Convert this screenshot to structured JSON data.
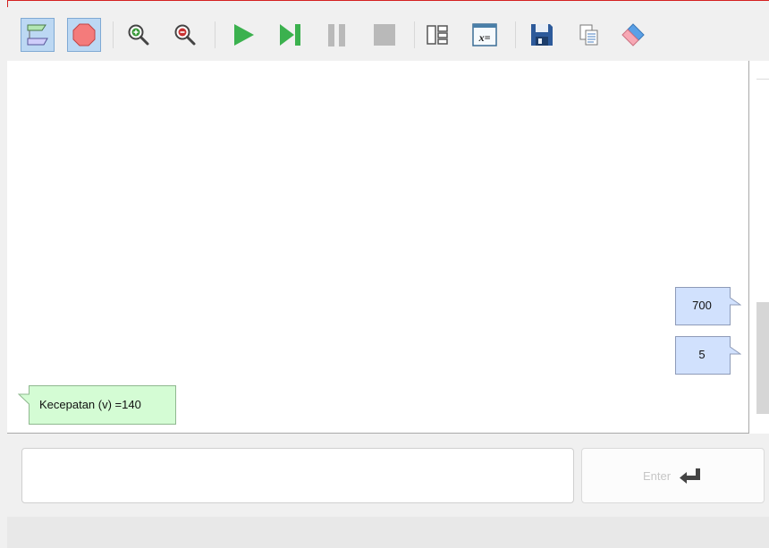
{
  "toolbar": {
    "buttons": [
      {
        "name": "mode-flowchart-button",
        "icon": "flowchart-icon",
        "pressed": true
      },
      {
        "name": "stop-mode-button",
        "icon": "stop-octagon-icon",
        "pressed": true
      },
      {
        "name": "zoom-in-button",
        "icon": "zoom-in-icon"
      },
      {
        "name": "zoom-out-button",
        "icon": "zoom-out-icon"
      },
      {
        "name": "run-button",
        "icon": "play-icon"
      },
      {
        "name": "step-button",
        "icon": "step-forward-icon"
      },
      {
        "name": "pause-button",
        "icon": "pause-icon"
      },
      {
        "name": "stop-button",
        "icon": "stop-square-icon"
      },
      {
        "name": "layout-button",
        "icon": "layout-icon"
      },
      {
        "name": "variables-button",
        "icon": "variables-icon",
        "text": "x="
      },
      {
        "name": "save-button",
        "icon": "floppy-disk-icon"
      },
      {
        "name": "copy-button",
        "icon": "copy-icon"
      },
      {
        "name": "clear-button",
        "icon": "eraser-icon"
      }
    ]
  },
  "console": {
    "input_1": "700",
    "input_2": "5",
    "output_1": "Kecepatan (v) =140"
  },
  "input": {
    "value": "",
    "enter_label": "Enter"
  },
  "colors": {
    "input_flag": "#d1e1fd",
    "output_flag": "#d4fcd4",
    "accent_border": "#d42020"
  }
}
